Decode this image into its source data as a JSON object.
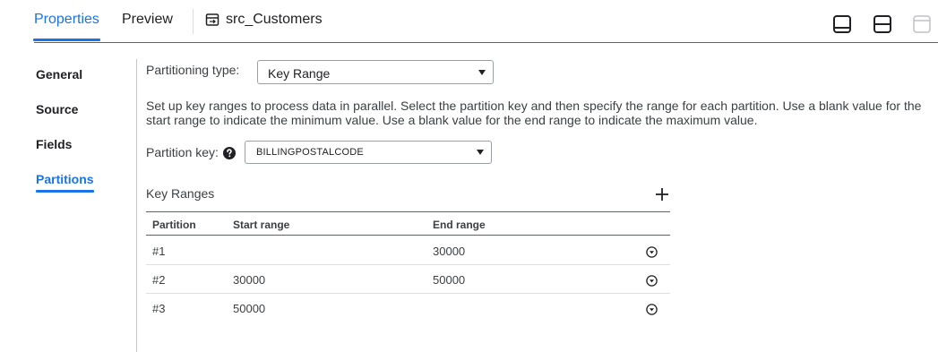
{
  "tabs": {
    "properties": "Properties",
    "preview": "Preview",
    "source_name": "src_Customers"
  },
  "sidenav": {
    "general": "General",
    "source": "Source",
    "fields": "Fields",
    "partitions": "Partitions",
    "active": "Partitions"
  },
  "partitioning": {
    "type_label": "Partitioning type:",
    "type_value": "Key Range",
    "description": "Set up key ranges to process data in parallel. Select the partition key and then specify the range for each partition. Use a blank value for the start range to indicate the minimum value. Use a blank value for the end range to indicate the maximum value.",
    "key_label": "Partition key:",
    "key_value": "BILLINGPOSTALCODE"
  },
  "key_ranges": {
    "title": "Key Ranges",
    "columns": [
      "Partition",
      "Start range",
      "End range"
    ],
    "rows": [
      {
        "partition": "#1",
        "start": "",
        "end": "30000"
      },
      {
        "partition": "#2",
        "start": "30000",
        "end": "50000"
      },
      {
        "partition": "#3",
        "start": "50000",
        "end": ""
      }
    ]
  },
  "icons": {
    "source": "table-source-icon",
    "layout_bottom": "panel-bottom-icon",
    "layout_split": "panel-split-icon",
    "layout_top": "panel-top-icon",
    "help": "help-icon",
    "add": "add-icon",
    "row_menu": "chevron-down-circle-icon"
  },
  "colors": {
    "accent": "#1a73e8",
    "text": "#202124",
    "divider": "#5f6368"
  }
}
